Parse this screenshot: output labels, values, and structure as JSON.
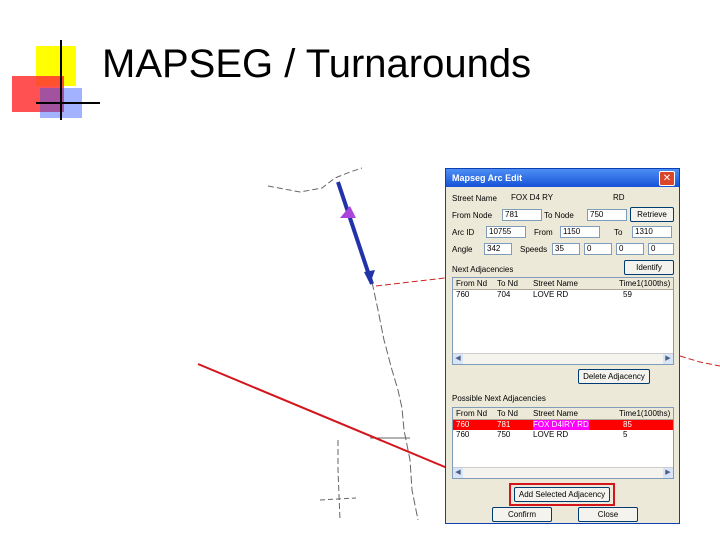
{
  "slide": {
    "title": "MAPSEG / Turnarounds"
  },
  "dialog": {
    "title": "Mapseg Arc Edit",
    "close_glyph": "✕",
    "fields": {
      "street_name_label": "Street Name",
      "street_name_value": "FOX D4 RY",
      "street_suffix_value": "RD",
      "from_node_label": "From Node",
      "from_node_value": "781",
      "to_node_label": "To Node",
      "to_node_value": "750",
      "retrieve_button": "Retrieve",
      "arc_id_label": "Arc ID",
      "arc_id_value": "10755",
      "from_label": "From",
      "from_value": "1150",
      "to_label": "To",
      "to_value": "1310",
      "angle_label": "Angle",
      "angle_value": "342",
      "speed_label": "Speeds",
      "speed_values": [
        "35",
        "0",
        "0",
        "0"
      ],
      "identify_button": "Identify"
    },
    "next_adjacencies": {
      "label": "Next Adjacencies",
      "columns": [
        "From Nd",
        "To Nd",
        "Street Name",
        "Time1(100ths)"
      ],
      "rows": [
        [
          "760",
          "704",
          "LOVE RD",
          "59"
        ]
      ],
      "delete_button": "Delete Adjacency"
    },
    "possible_adjacencies": {
      "label": "Possible Next Adjacencies",
      "columns": [
        "From Nd",
        "To Nd",
        "Street Name",
        "Time1(100ths)"
      ],
      "rows": [
        [
          "760",
          "781",
          "FOX D4IRY RD",
          "85"
        ],
        [
          "760",
          "750",
          "LOVE RD",
          "5"
        ]
      ],
      "add_button": "Add Selected Adjacency"
    },
    "confirm_button": "Confirm",
    "close_button": "Close"
  },
  "colors": {
    "highlight_red": "#d4161c",
    "road_red": "#cc2222",
    "arc_blue": "#2233aa",
    "arc_purple": "#aa44dd"
  }
}
